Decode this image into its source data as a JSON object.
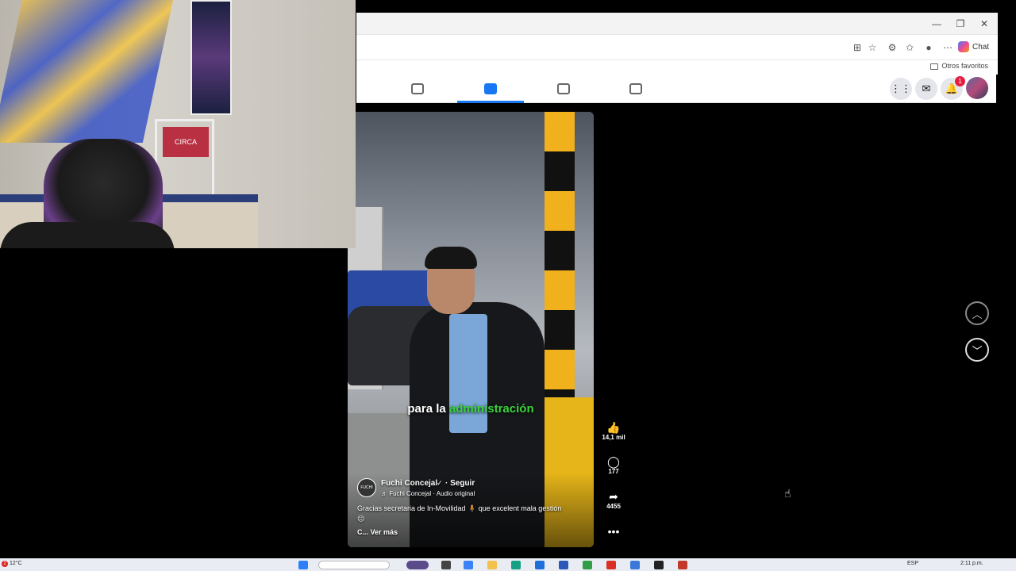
{
  "browser": {
    "chat_label": "Chat",
    "favorites_folder_label": "Otros favoritos"
  },
  "webcam": {
    "box_text": "CIRCA"
  },
  "reel": {
    "caption_plain": "para la",
    "caption_highlight": "administración",
    "author_avatar_text": "FUCHI",
    "author_name": "Fuchi Concejal",
    "follow_label": "· Seguir",
    "audio_label": "♬ Fuchi Concejal · Audio original",
    "description": "Gracias secretaria de In-Movilidad 🧍 que excelent mala gestión",
    "description_emoji": "😐",
    "see_more": "C... Ver más",
    "likes": "14,1 mil",
    "comments": "177",
    "shares": "4455"
  },
  "nav": {
    "notification_count": "1"
  },
  "taskbar": {
    "weather_badge": "2",
    "temperature": "12°C",
    "language": "ESP",
    "time": "2:11 p.m."
  },
  "colors": {
    "fb_blue": "#1877f2",
    "caption_highlight": "#3ad43a",
    "notif_red": "#e41e3f"
  },
  "icons": {
    "tabs": [
      "home-icon",
      "video-icon",
      "marketplace-icon",
      "gaming-icon"
    ],
    "actions": [
      "like-icon",
      "comment-icon",
      "share-icon",
      "more-icon"
    ]
  }
}
